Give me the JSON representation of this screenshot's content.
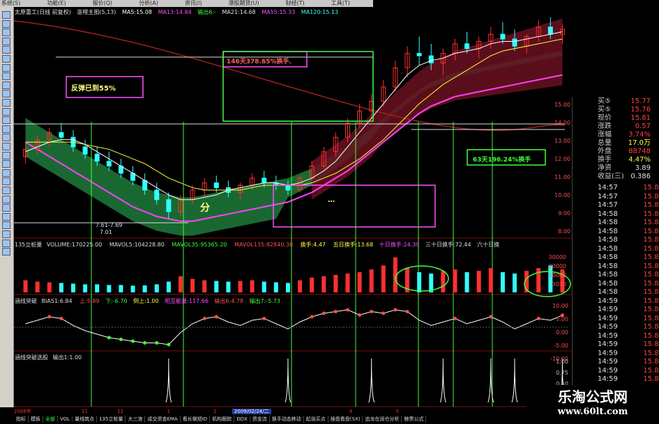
{
  "menu": [
    "系统(S)",
    "功能(E)",
    "报价(Q)",
    "分析(A)",
    "资讯(I)",
    "港股期货(U)",
    "财经(T)",
    "工具(T)"
  ],
  "title": {
    "name": "太原重工(日线 前复权)",
    "indicator": "巫哩主图(5,13)",
    "ma5": "MA5:15.08",
    "ma13": "MA13:14.84",
    "out6": "输出6:-",
    "ma21": "MA21:14.68",
    "ma55": "MA55:15.33",
    "ma120": "MA120:15.13"
  },
  "volume_header": {
    "name": "135立桩量",
    "volume": "VOLUME:170225.00",
    "mavol5": "MAVOL5:104228.80",
    "mavol35": "MAVOL35:95365.20",
    "mavol135": "MAVOL135:82840.38",
    "turnover": "换手:4.47",
    "t5": "五日换手:13.68",
    "t10": "十日换手:24.39",
    "t30": "三十日换手:72.44",
    "t60": "六十日换"
  },
  "bias_header": {
    "name": "涵线突破",
    "bias": "BIAS1:6.84",
    "up": "上:5.89",
    "down": "下:-6.70",
    "up2": "倒上:1.00",
    "score": "相互能量:117.66",
    "out6": "输出6:4.78",
    "out7": "输出7:-5.73"
  },
  "signal_header": {
    "name": "涵线突破选股",
    "out1": "输出1:1.00"
  },
  "annotations": {
    "rebound": "反弹已到55%",
    "days146": "146天378.65%换手.",
    "days63": "63天196.24%换手",
    "low": "7.61-7.69",
    "low2": "7.01",
    "fen": "分",
    "boxtext": "…"
  },
  "axis_price": [
    "15.00",
    "14.00",
    "13.00",
    "12.00",
    "11.00",
    "10.00",
    "9.00",
    "8.00"
  ],
  "axis_volume": [
    "30000",
    "20000",
    "10000",
    "3070"
  ],
  "axis_bias": [
    "10.00",
    "5.00",
    "0.00",
    "-5.00",
    "-10.00"
  ],
  "axis_signal": [
    "1.00",
    "0.75",
    "0.50",
    "0.25"
  ],
  "quote": [
    {
      "label": "买⑤",
      "value": "15.77",
      "color": "#ff4040"
    },
    {
      "label": "买⑤",
      "value": "15.76",
      "color": "#ff4040"
    },
    {
      "label": "现价",
      "value": "15.81",
      "color": "#ff4040"
    },
    {
      "label": "涨跌",
      "value": "0.57",
      "color": "#ff4040"
    },
    {
      "label": "涨幅",
      "value": "3.74%",
      "color": "#ff4040"
    },
    {
      "label": "总量",
      "value": "17.0万",
      "color": "#ffff40"
    },
    {
      "label": "外盘",
      "value": "88748",
      "color": "#ff4040"
    },
    {
      "label": "换手",
      "value": "4.47%",
      "color": "#ffff40"
    },
    {
      "label": "净资",
      "value": "3.89",
      "color": "#e0e0e0"
    },
    {
      "label": "收益(三)",
      "value": "0.386",
      "color": "#e0e0e0"
    }
  ],
  "ticks": [
    {
      "time": "14:57",
      "price": "15.81"
    },
    {
      "time": "14:57",
      "price": "15.81"
    },
    {
      "time": "14:57",
      "price": "15.81"
    },
    {
      "time": "14:58",
      "price": "15.81"
    },
    {
      "time": "14:58",
      "price": "15.81"
    },
    {
      "time": "14:58",
      "price": "15.81"
    },
    {
      "time": "14:58",
      "price": "15.81"
    },
    {
      "time": "14:58",
      "price": "15.81"
    },
    {
      "time": "14:58",
      "price": "15.81"
    },
    {
      "time": "14:58",
      "price": "15.81"
    },
    {
      "time": "14:58",
      "price": "15.81"
    },
    {
      "time": "14:58",
      "price": "15.81"
    },
    {
      "time": "14:58",
      "price": "15.81"
    },
    {
      "time": "14:59",
      "price": "15.81"
    },
    {
      "time": "14:59",
      "price": "15.81"
    },
    {
      "time": "14:59",
      "price": "15.81"
    },
    {
      "time": "14:59",
      "price": "15.81"
    },
    {
      "time": "14:59",
      "price": "15.81"
    },
    {
      "time": "14:59",
      "price": "15.81"
    },
    {
      "time": "14:59",
      "price": "15.81"
    },
    {
      "time": "14:59",
      "price": "15.81"
    },
    {
      "time": "14:59",
      "price": "15.81"
    },
    {
      "time": "14:59",
      "price": "15.81"
    },
    {
      "time": "14:59",
      "price": "15.81"
    }
  ],
  "date_bar": {
    "year": "2008年",
    "m11": "11",
    "m12": "12",
    "d1": "1",
    "d2": "2",
    "current": "2009/02/24/二",
    "d4": "4",
    "d5": "5"
  },
  "tabs": [
    "指标",
    "模板",
    "全部",
    "VOL",
    "量线筑点",
    "135立桩量",
    "大三浪",
    "成交资金EMA",
    "看长做短ID",
    "机构跟踪",
    "DDX",
    "资金流",
    "换手动态移动",
    "起涨买点",
    "操盘看盘(SX)",
    "追龙在润仓分析",
    "鲸票公式"
  ],
  "watermark": {
    "name": "乐淘公式网",
    "url": "www.60lt.com"
  },
  "chart_data": {
    "type": "candlestick",
    "title": "太原重工(日线 前复权)",
    "ylim": [
      7.0,
      16.0
    ],
    "candles": [
      {
        "o": 10.2,
        "h": 10.8,
        "l": 9.9,
        "c": 10.5
      },
      {
        "o": 10.5,
        "h": 11.1,
        "l": 10.3,
        "c": 10.9
      },
      {
        "o": 10.9,
        "h": 11.4,
        "l": 10.6,
        "c": 11.2
      },
      {
        "o": 11.2,
        "h": 11.6,
        "l": 10.9,
        "c": 11.0
      },
      {
        "o": 11.0,
        "h": 11.3,
        "l": 10.4,
        "c": 10.6
      },
      {
        "o": 10.6,
        "h": 10.9,
        "l": 10.1,
        "c": 10.3
      },
      {
        "o": 10.3,
        "h": 10.6,
        "l": 9.8,
        "c": 10.0
      },
      {
        "o": 10.0,
        "h": 10.4,
        "l": 9.6,
        "c": 9.8
      },
      {
        "o": 9.8,
        "h": 10.1,
        "l": 9.3,
        "c": 9.5
      },
      {
        "o": 9.5,
        "h": 9.8,
        "l": 9.0,
        "c": 9.2
      },
      {
        "o": 9.2,
        "h": 9.5,
        "l": 8.6,
        "c": 8.8
      },
      {
        "o": 8.8,
        "h": 9.1,
        "l": 8.2,
        "c": 8.4
      },
      {
        "o": 8.4,
        "h": 8.7,
        "l": 7.6,
        "c": 7.9
      },
      {
        "o": 7.9,
        "h": 8.6,
        "l": 7.7,
        "c": 8.4
      },
      {
        "o": 8.4,
        "h": 9.0,
        "l": 8.2,
        "c": 8.8
      },
      {
        "o": 8.8,
        "h": 9.3,
        "l": 8.5,
        "c": 9.1
      },
      {
        "o": 9.1,
        "h": 9.4,
        "l": 8.7,
        "c": 8.9
      },
      {
        "o": 8.9,
        "h": 9.2,
        "l": 8.5,
        "c": 8.7
      },
      {
        "o": 8.7,
        "h": 9.1,
        "l": 8.4,
        "c": 9.0
      },
      {
        "o": 9.0,
        "h": 9.5,
        "l": 8.8,
        "c": 9.3
      },
      {
        "o": 9.3,
        "h": 9.6,
        "l": 8.9,
        "c": 9.1
      },
      {
        "o": 9.1,
        "h": 9.4,
        "l": 8.8,
        "c": 9.0
      },
      {
        "o": 9.0,
        "h": 9.2,
        "l": 8.6,
        "c": 8.8
      },
      {
        "o": 8.8,
        "h": 9.4,
        "l": 8.7,
        "c": 9.3
      },
      {
        "o": 9.3,
        "h": 10.0,
        "l": 9.2,
        "c": 9.8
      },
      {
        "o": 9.8,
        "h": 10.6,
        "l": 9.7,
        "c": 10.4
      },
      {
        "o": 10.4,
        "h": 11.2,
        "l": 10.2,
        "c": 11.0
      },
      {
        "o": 11.0,
        "h": 11.8,
        "l": 10.8,
        "c": 11.6
      },
      {
        "o": 11.6,
        "h": 12.4,
        "l": 11.4,
        "c": 12.1
      },
      {
        "o": 12.1,
        "h": 12.8,
        "l": 11.8,
        "c": 12.5
      },
      {
        "o": 12.5,
        "h": 13.4,
        "l": 12.3,
        "c": 13.1
      },
      {
        "o": 13.1,
        "h": 14.2,
        "l": 12.9,
        "c": 13.9
      },
      {
        "o": 13.9,
        "h": 14.8,
        "l": 13.5,
        "c": 14.5
      },
      {
        "o": 14.5,
        "h": 15.2,
        "l": 14.0,
        "c": 14.4
      },
      {
        "o": 14.4,
        "h": 14.9,
        "l": 13.8,
        "c": 14.1
      },
      {
        "o": 14.1,
        "h": 14.7,
        "l": 13.6,
        "c": 14.5
      },
      {
        "o": 14.5,
        "h": 15.1,
        "l": 14.2,
        "c": 14.9
      },
      {
        "o": 14.9,
        "h": 15.4,
        "l": 14.5,
        "c": 14.7
      },
      {
        "o": 14.7,
        "h": 15.2,
        "l": 14.3,
        "c": 15.0
      },
      {
        "o": 15.0,
        "h": 15.6,
        "l": 14.7,
        "c": 15.3
      },
      {
        "o": 15.3,
        "h": 15.8,
        "l": 14.9,
        "c": 15.1
      },
      {
        "o": 15.1,
        "h": 15.5,
        "l": 14.6,
        "c": 14.8
      },
      {
        "o": 14.8,
        "h": 15.3,
        "l": 14.5,
        "c": 15.2
      },
      {
        "o": 15.2,
        "h": 15.9,
        "l": 15.0,
        "c": 15.6
      },
      {
        "o": 15.6,
        "h": 16.0,
        "l": 15.1,
        "c": 15.3
      },
      {
        "o": 15.3,
        "h": 15.7,
        "l": 14.9,
        "c": 15.5
      }
    ],
    "ma5": [
      10.4,
      10.6,
      10.8,
      10.9,
      10.9,
      10.7,
      10.4,
      10.1,
      9.8,
      9.5,
      9.2,
      8.9,
      8.6,
      8.4,
      8.4,
      8.5,
      8.6,
      8.8,
      8.9,
      9.0,
      9.1,
      9.1,
      9.0,
      9.1,
      9.3,
      9.6,
      10.0,
      10.6,
      11.2,
      11.8,
      12.4,
      13.0,
      13.6,
      14.0,
      14.2,
      14.3,
      14.5,
      14.6,
      14.7,
      14.9,
      15.0,
      15.0,
      15.1,
      15.2,
      15.3,
      15.4
    ],
    "ma13": [
      10.8,
      10.8,
      10.8,
      10.8,
      10.8,
      10.7,
      10.6,
      10.5,
      10.3,
      10.1,
      9.9,
      9.6,
      9.3,
      9.1,
      8.9,
      8.8,
      8.8,
      8.8,
      8.8,
      8.9,
      9.0,
      9.0,
      9.0,
      9.0,
      9.1,
      9.3,
      9.5,
      9.8,
      10.1,
      10.5,
      10.9,
      11.4,
      11.9,
      12.4,
      12.8,
      13.2,
      13.5,
      13.8,
      14.1,
      14.4,
      14.6,
      14.7,
      14.8,
      14.9,
      15.0,
      15.1
    ],
    "volume": [
      9000,
      8000,
      7500,
      7000,
      6500,
      6000,
      6000,
      5500,
      5500,
      5000,
      5200,
      6000,
      8000,
      12000,
      10000,
      9000,
      8500,
      8000,
      8500,
      9000,
      8000,
      7500,
      7000,
      9000,
      11000,
      12000,
      13000,
      14000,
      15000,
      17000,
      20000,
      26000,
      18000,
      15000,
      14000,
      16000,
      17000,
      15000,
      16000,
      18000,
      15000,
      14000,
      16000,
      18000,
      20000,
      17022
    ],
    "bias": [
      2,
      4,
      6,
      5,
      1,
      -2,
      -4,
      -6,
      -7,
      -8,
      -9,
      -9,
      -10,
      -3,
      2,
      5,
      6,
      3,
      1,
      4,
      5,
      2,
      -1,
      3,
      6,
      8,
      9,
      10,
      7,
      9,
      8,
      10,
      9,
      4,
      1,
      3,
      5,
      2,
      4,
      6,
      3,
      -1,
      2,
      5,
      4,
      6.84
    ],
    "signal": [
      0,
      0,
      0,
      0,
      0,
      0,
      0,
      0,
      0,
      0,
      0,
      0,
      1,
      0,
      0,
      0,
      0,
      0,
      0,
      0,
      0,
      0,
      1,
      0,
      0,
      0,
      0,
      0,
      0,
      1,
      0,
      0,
      0,
      0,
      0,
      1,
      0,
      0,
      0,
      1,
      0,
      1,
      0,
      0,
      0,
      1
    ]
  }
}
